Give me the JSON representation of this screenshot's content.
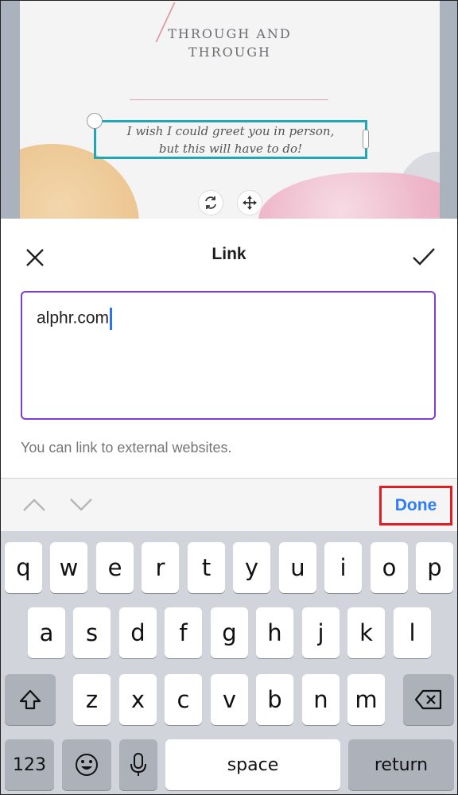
{
  "canvas": {
    "heading_line1": "THROUGH AND",
    "heading_line2": "THROUGH",
    "text_line1": "I wish I could greet you in person,",
    "text_line2": "but this will have to do!",
    "rotate_icon": "rotate-icon",
    "move_icon": "move-icon"
  },
  "dialog": {
    "title": "Link",
    "close_icon": "close-icon",
    "confirm_icon": "checkmark-icon",
    "input_value": "alphr.com",
    "helper_text": "You can link to external websites.",
    "accent_color": "#7d3fd1"
  },
  "accessory_bar": {
    "up_icon": "chevron-up-icon",
    "down_icon": "chevron-down-icon",
    "done_label": "Done",
    "highlight_color": "#e01c24"
  },
  "keyboard": {
    "row1": [
      "q",
      "w",
      "e",
      "r",
      "t",
      "y",
      "u",
      "i",
      "o",
      "p"
    ],
    "row2": [
      "a",
      "s",
      "d",
      "f",
      "g",
      "h",
      "j",
      "k",
      "l"
    ],
    "row3": [
      "z",
      "x",
      "c",
      "v",
      "b",
      "n",
      "m"
    ],
    "shift_icon": "shift-icon",
    "backspace_icon": "backspace-icon",
    "numbers_label": "123",
    "emoji_icon": "emoji-icon",
    "mic_icon": "microphone-icon",
    "space_label": "space",
    "return_label": "return"
  }
}
